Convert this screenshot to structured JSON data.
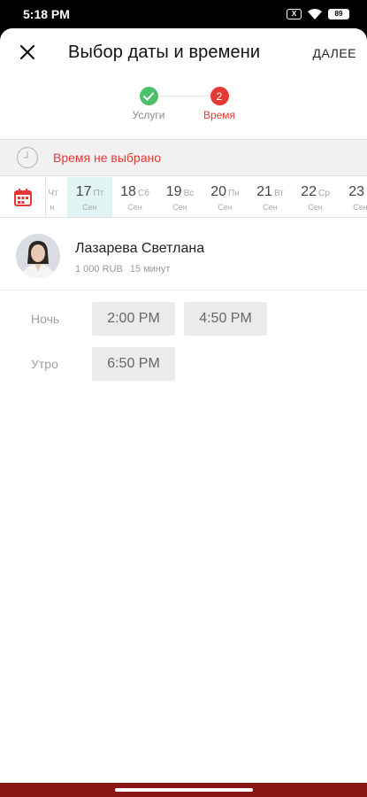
{
  "status_bar": {
    "time": "5:18 PM",
    "sim_label": "X",
    "battery": "89"
  },
  "header": {
    "title": "Выбор даты и времени",
    "next_label": "ДАЛЕЕ"
  },
  "stepper": {
    "steps": [
      {
        "label": "Услуги",
        "state": "done",
        "icon": "check-icon",
        "color": "#4cbf6b"
      },
      {
        "label": "Время",
        "number": "2",
        "state": "active",
        "color": "#e53935"
      }
    ]
  },
  "time_status": {
    "text": "Время не выбрано",
    "color": "#e53935"
  },
  "dates": [
    {
      "day": "",
      "dow": "Чт",
      "month": "н",
      "partial": true
    },
    {
      "day": "17",
      "dow": "Пт",
      "month": "Сен",
      "selected": true
    },
    {
      "day": "18",
      "dow": "Сб",
      "month": "Сен"
    },
    {
      "day": "19",
      "dow": "Вс",
      "month": "Сен"
    },
    {
      "day": "20",
      "dow": "Пн",
      "month": "Сен"
    },
    {
      "day": "21",
      "dow": "Вт",
      "month": "Сен"
    },
    {
      "day": "22",
      "dow": "Ср",
      "month": "Сен"
    },
    {
      "day": "23",
      "dow": "Ч",
      "month": "Сен"
    }
  ],
  "specialist": {
    "name": "Лазарева Светлана",
    "price": "1 000 RUB",
    "duration": "15 минут"
  },
  "slots": [
    {
      "period": "Ночь",
      "times": [
        "2:00 PM",
        "4:50 PM"
      ]
    },
    {
      "period": "Утро",
      "times": [
        "6:50 PM"
      ]
    }
  ],
  "colors": {
    "accent": "#e53935",
    "success": "#4cbf6b",
    "selected_date_bg": "#e1f4f4",
    "nav_bar": "#8b1414"
  }
}
